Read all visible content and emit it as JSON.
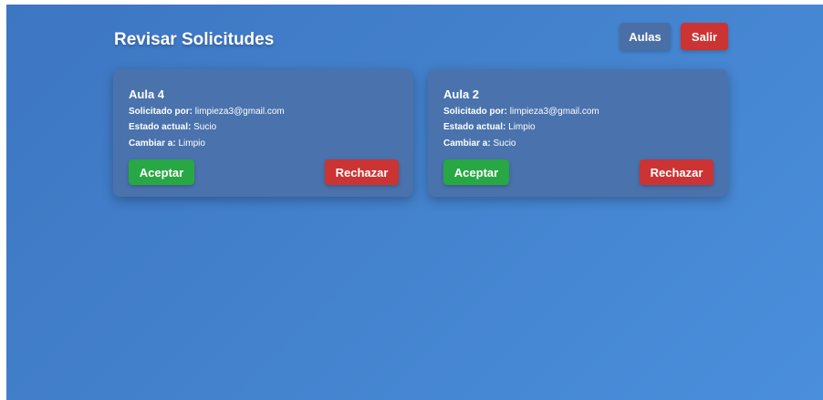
{
  "header": {
    "title": "Revisar Solicitudes",
    "aulas_label": "Aulas",
    "salir_label": "Salir"
  },
  "requests": [
    {
      "aula": "Aula 4",
      "requested_by_label": "Solicitado por:",
      "requested_by": "limpieza3@gmail.com",
      "current_state_label": "Estado actual:",
      "current_state": "Sucio",
      "change_to_label": "Cambiar a:",
      "change_to": "Limpio",
      "accept_label": "Aceptar",
      "reject_label": "Rechazar"
    },
    {
      "aula": "Aula 2",
      "requested_by_label": "Solicitado por:",
      "requested_by": "limpieza3@gmail.com",
      "current_state_label": "Estado actual:",
      "current_state": "Limpio",
      "change_to_label": "Cambiar a:",
      "change_to": "Sucio",
      "accept_label": "Aceptar",
      "reject_label": "Rechazar"
    }
  ],
  "colors": {
    "background_start": "#3d76c2",
    "background_end": "#4a8fdc",
    "card": "#4a72ad",
    "accept": "#28a745",
    "reject": "#cc3333",
    "aulas_button": "#4a6fa6"
  }
}
